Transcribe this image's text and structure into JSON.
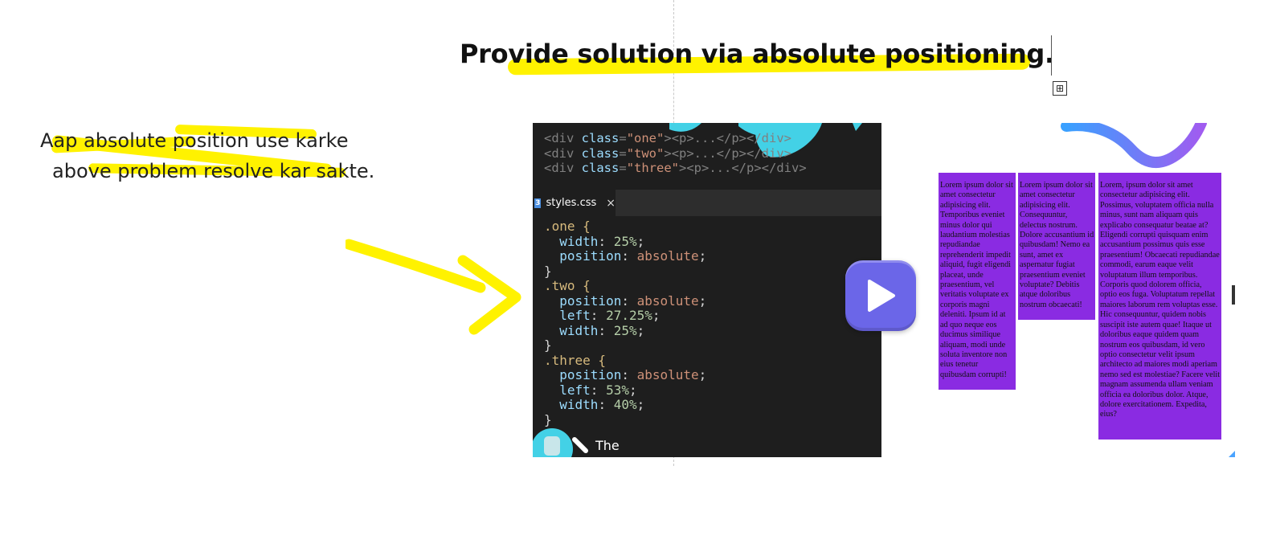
{
  "slide": {
    "title": "Provide solution via absolute positioning.",
    "note_line1": "Aap absolute position use karke",
    "note_line2": "above problem resolve kar sakte.",
    "move_handle_glyph": "⊞"
  },
  "highlight_color": "#fff200",
  "editor": {
    "html_lines": [
      {
        "tag_open": "<div ",
        "attr": "class",
        "eq": "=",
        "value": "\"one\"",
        "rest": "><p>...</p></div>"
      },
      {
        "tag_open": "<div ",
        "attr": "class",
        "eq": "=",
        "value": "\"two\"",
        "rest": "><p>...</p></div>"
      },
      {
        "tag_open": "<div ",
        "attr": "class",
        "eq": "=",
        "value": "\"three\"",
        "rest": "><p>...</p></div>"
      }
    ],
    "tab_label": "styles.css",
    "tab_close": "×",
    "css_icon": "3",
    "css_rules": [
      {
        "selector": ".one {",
        "decls": [
          {
            "prop": "width",
            "val": "25%",
            "numeric": true
          },
          {
            "prop": "position",
            "val": "absolute",
            "numeric": false
          }
        ]
      },
      {
        "selector": ".two {",
        "decls": [
          {
            "prop": "position",
            "val": "absolute",
            "numeric": false
          },
          {
            "prop": "left",
            "val": "27.25%",
            "numeric": true
          },
          {
            "prop": "width",
            "val": "25%",
            "numeric": true
          }
        ]
      },
      {
        "selector": ".three {",
        "decls": [
          {
            "prop": "position",
            "val": "absolute",
            "numeric": false
          },
          {
            "prop": "left",
            "val": "53%",
            "numeric": true
          },
          {
            "prop": "width",
            "val": "40%",
            "numeric": true
          }
        ]
      }
    ],
    "bottom_text": "The"
  },
  "preview": {
    "box_color": "#8a2be2",
    "box_one_text": "Lorem ipsum dolor sit amet consectetur adipisicing elit. Temporibus eveniet minus dolor qui laudantium molestias repudiandae reprehenderit impedit aliquid, fugit eligendi placeat, unde praesentium, vel veritatis voluptate ex corporis magni deleniti. Ipsum id at ad quo neque eos ducimus similique aliquam, modi unde soluta inventore non eius tenetur quibusdam corrupti!",
    "box_two_text": "Lorem ipsum dolor sit amet consectetur adipisicing elit. Consequuntur, delectus nostrum. Dolore accusantium id quibusdam! Nemo ea sunt, amet ex aspernatur fugiat praesentium eveniet voluptate? Debitis atque doloribus nostrum obcaecati!",
    "box_three_text": "Lorem, ipsum dolor sit amet consectetur adipisicing elit. Possimus, voluptatem officia nulla minus, sunt nam aliquam quis explicabo consequatur beatae at? Eligendi corrupti quisquam enim accusantium possimus quis esse praesentium! Obcaecati repudiandae commodi, earum eaque velit voluptatum illum temporibus. Corporis quod dolorem officia, optio eos fuga. Voluptatum repellat maiores laborum rem voluptas esse. Hic consequuntur, quidem nobis suscipit iste autem quae! Itaque ut doloribus eaque quidem quam nostrum eos quibusdam, id vero optio consectetur velit ipsum architecto ad maiores modi aperiam nemo sed est molestiae? Facere velit magnam assumenda ullam veniam officia ea doloribus dolor. Atque, dolore exercitationem. Expedita, eius?"
  },
  "play_button": {
    "color": "#6b66e8",
    "icon": "play-icon"
  }
}
